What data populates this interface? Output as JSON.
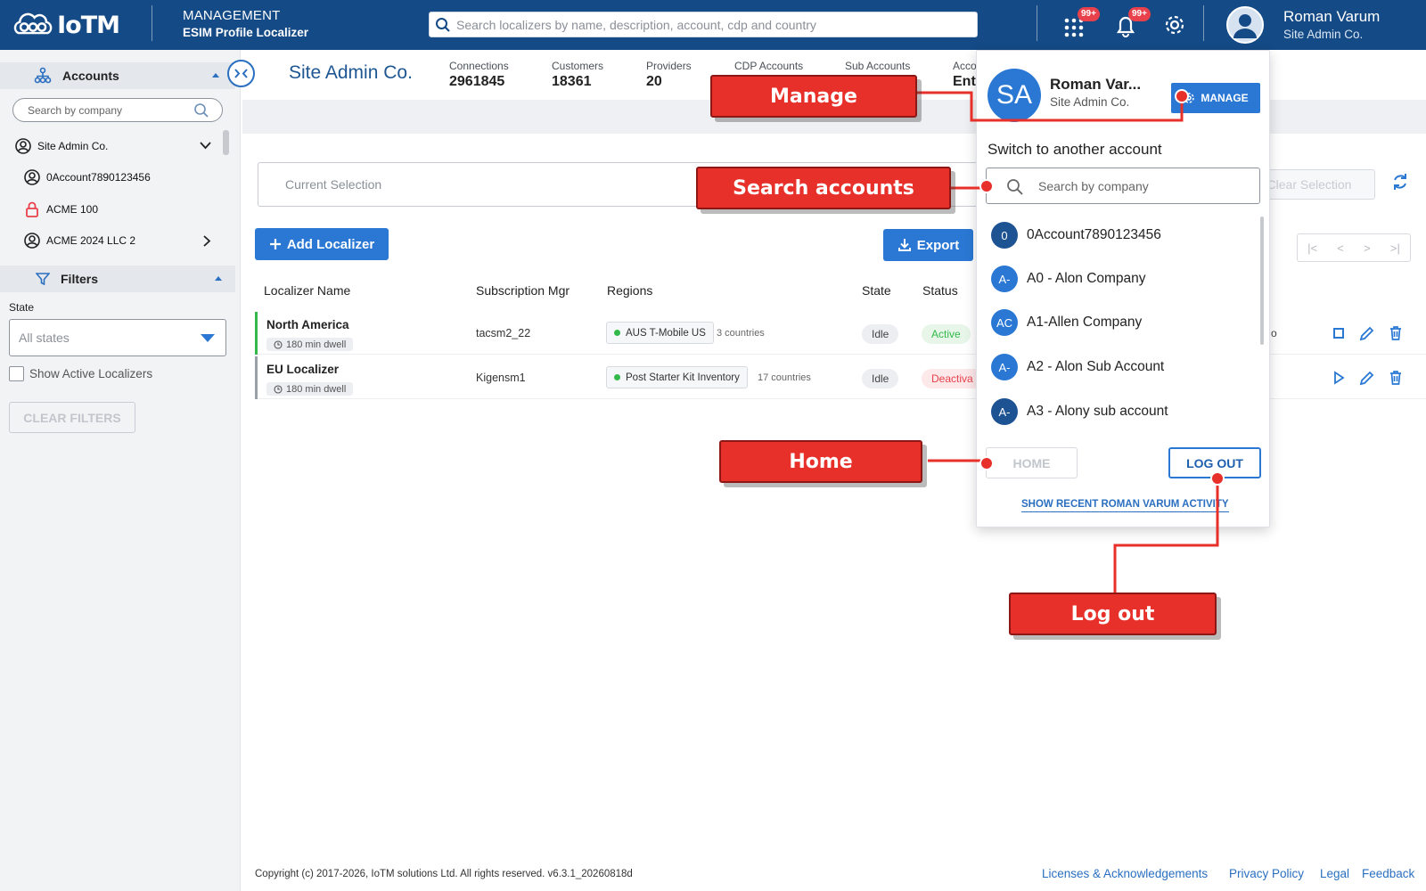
{
  "app": {
    "logo_text": "IoTM",
    "section": "MANAGEMENT",
    "subtitle": "ESIM Profile Localizer"
  },
  "search": {
    "placeholder": "Search localizers by name, description, account, cdp and country"
  },
  "notifications": {
    "apps_badge": "99+",
    "bell_badge": "99+"
  },
  "user": {
    "name": "Roman Varum",
    "company": "Site Admin Co."
  },
  "sidebar": {
    "accounts_label": "Accounts",
    "search_placeholder": "Search by company",
    "accounts": [
      {
        "label": "Site Admin Co.",
        "icon": "account-circle-icon"
      },
      {
        "label": "0Account7890123456",
        "icon": "account-circle-icon"
      },
      {
        "label": "ACME 100",
        "icon": "lock-icon"
      },
      {
        "label": "ACME 2024 LLC 2",
        "icon": "account-circle-icon"
      }
    ],
    "filters_label": "Filters",
    "state_label": "State",
    "state_value": "All states",
    "show_active_label": "Show Active Localizers",
    "clear_filters_label": "CLEAR FILTERS"
  },
  "header": {
    "title": "Site Admin Co.",
    "stats": [
      {
        "label": "Connections",
        "value": "2961845"
      },
      {
        "label": "Customers",
        "value": "18361"
      },
      {
        "label": "Providers",
        "value": "20"
      },
      {
        "label": "CDP Accounts",
        "value": ""
      },
      {
        "label": "Sub Accounts",
        "value": ""
      },
      {
        "label": "Acco",
        "value": "Ent"
      }
    ]
  },
  "selection": {
    "placeholder": "Current Selection",
    "clear_label": "Clear Selection"
  },
  "toolbar": {
    "add_label": "Add Localizer",
    "export_label": "Export"
  },
  "table": {
    "columns": [
      "Localizer Name",
      "Subscription Mgr",
      "Regions",
      "State",
      "Status"
    ],
    "rows": [
      {
        "name": "North America",
        "dwell": "180 min dwell",
        "mgr": "tacsm2_22",
        "region": "AUS T-Mobile US",
        "countries": "3 countries",
        "state": "Idle",
        "status": "Active",
        "extra": "o"
      },
      {
        "name": "EU Localizer",
        "dwell": "180 min dwell",
        "mgr": "Kigensm1",
        "region": "Post Starter Kit Inventory",
        "countries": "17 countries",
        "state": "Idle",
        "status": "Deactiva",
        "extra": ""
      }
    ]
  },
  "popup": {
    "avatar": "SA",
    "name": "Roman Var...",
    "company": "Site Admin Co.",
    "manage_label": "MANAGE",
    "switch_label": "Switch to another account",
    "search_placeholder": "Search by company",
    "accounts": [
      {
        "badge": "0",
        "label": "0Account7890123456"
      },
      {
        "badge": "A-",
        "label": "A0 - Alon Company"
      },
      {
        "badge": "AC",
        "label": "A1-Allen Company"
      },
      {
        "badge": "A-",
        "label": "A2 - Alon Sub Account"
      },
      {
        "badge": "A-",
        "label": "A3 - Alony sub account"
      }
    ],
    "home_label": "HOME",
    "logout_label": "LOG OUT",
    "recent_label": "SHOW RECENT ROMAN VARUM ACTIVITY"
  },
  "callouts": {
    "manage": "Manage",
    "search": "Search accounts",
    "home": "Home",
    "logout": "Log out"
  },
  "footer": {
    "copyright": "Copyright (c) 2017-2026, IoTM solutions Ltd. All rights reserved. v6.3.1_20260818d",
    "links": [
      "Licenses & Acknowledgements",
      "Privacy Policy",
      "Legal",
      "Feedback"
    ]
  },
  "colors": {
    "header": "#144a86",
    "accent": "#2a78d4",
    "callout": "#e8302a",
    "active": "#32b94a",
    "inactive": "#e8414b"
  }
}
